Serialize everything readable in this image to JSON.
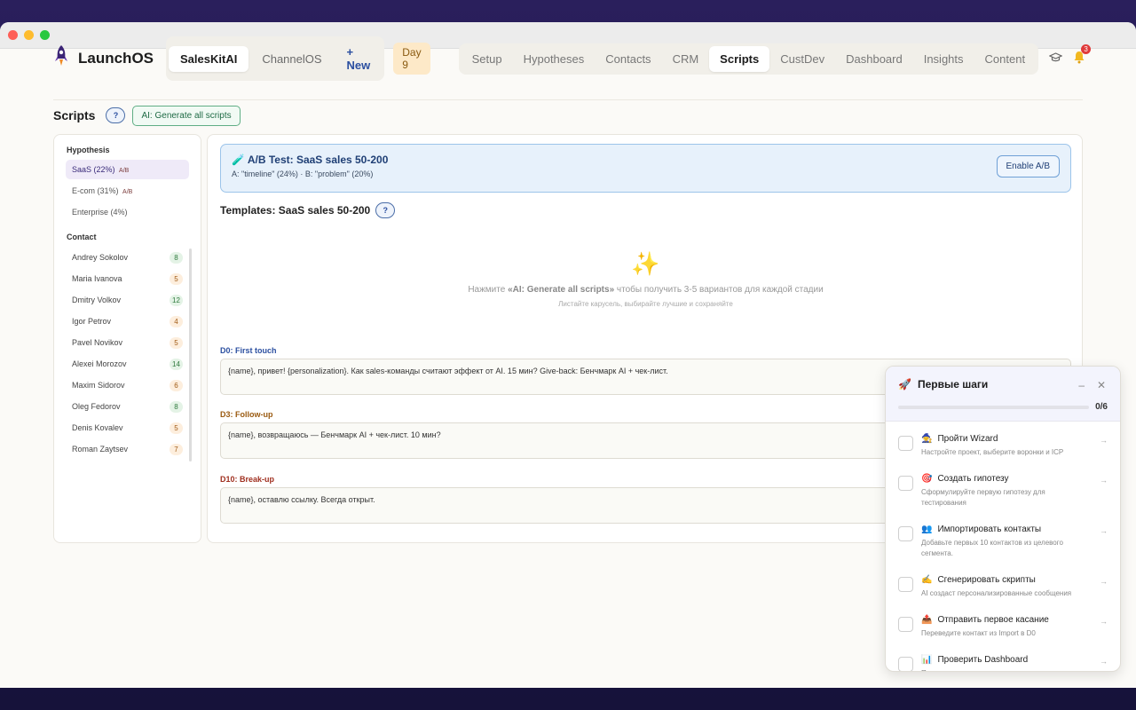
{
  "app": {
    "name": "LaunchOS"
  },
  "project_tabs": [
    {
      "label": "SalesKitAI",
      "active": true
    },
    {
      "label": "ChannelOS",
      "active": false
    },
    {
      "label": "+ New",
      "active": false
    }
  ],
  "day_badge": "Day 9",
  "nav_tabs": [
    {
      "label": "Setup"
    },
    {
      "label": "Hypotheses"
    },
    {
      "label": "Contacts"
    },
    {
      "label": "CRM"
    },
    {
      "label": "Scripts"
    },
    {
      "label": "CustDev"
    },
    {
      "label": "Dashboard"
    },
    {
      "label": "Insights"
    },
    {
      "label": "Content"
    }
  ],
  "active_nav": "Scripts",
  "notifications_count": "3",
  "page": {
    "title": "Scripts",
    "help": "?",
    "ai_button": "AI: Generate all scripts"
  },
  "sidebar": {
    "hypothesis_heading": "Hypothesis",
    "hypotheses": [
      {
        "label": "SaaS (22%)",
        "tag": "A/B"
      },
      {
        "label": "E-com (31%)",
        "tag": "A/B"
      },
      {
        "label": "Enterprise (4%)",
        "tag": ""
      }
    ],
    "contact_heading": "Contact",
    "contacts": [
      {
        "name": "Andrey Sokolov",
        "count": "8",
        "color": "green"
      },
      {
        "name": "Maria Ivanova",
        "count": "5",
        "color": "orange"
      },
      {
        "name": "Dmitry Volkov",
        "count": "12",
        "color": "green"
      },
      {
        "name": "Igor Petrov",
        "count": "4",
        "color": "orange"
      },
      {
        "name": "Pavel Novikov",
        "count": "5",
        "color": "orange"
      },
      {
        "name": "Alexei Morozov",
        "count": "14",
        "color": "green"
      },
      {
        "name": "Maxim Sidorov",
        "count": "6",
        "color": "orange"
      },
      {
        "name": "Oleg Fedorov",
        "count": "8",
        "color": "green"
      },
      {
        "name": "Denis Kovalev",
        "count": "5",
        "color": "orange"
      },
      {
        "name": "Roman Zaytsev",
        "count": "7",
        "color": "orange"
      }
    ]
  },
  "ab_test": {
    "title": "A/B Test: SaaS sales 50-200",
    "subtitle": "A: \"timeline\" (24%) · B: \"problem\" (20%)",
    "enable_button": "Enable A/B"
  },
  "templates": {
    "title": "Templates: SaaS sales 50-200",
    "help": "?",
    "empty_prefix": "Нажмите ",
    "empty_bold": "«AI: Generate all scripts»",
    "empty_suffix": " чтобы получить 3-5 вариантов для каждой стадии",
    "empty_sub": "Листайте карусель, выбирайте лучшие и сохраняйте"
  },
  "stages": [
    {
      "label": "D0: First touch",
      "text": "{name}, привет! {personalization}. Как sales-команды считают эффект от AI. 15 мин? Give-back: Бенчмарк AI + чек-лист.",
      "color": "#2b4fa0"
    },
    {
      "label": "D3: Follow-up",
      "text": "{name}, возвращаюсь — Бенчмарк AI + чек-лист. 10 мин?",
      "color": "#9a5a10"
    },
    {
      "label": "D10: Break-up",
      "text": "{name}, оставлю ссылку. Всегда открыт.",
      "color": "#a03020"
    }
  ],
  "onboarding": {
    "title": "Первые шаги",
    "progress_text": "0/6",
    "progress_fraction": 0,
    "items": [
      {
        "icon": "🧙",
        "title": "Пройти Wizard",
        "desc": "Настройте проект, выберите воронки и ICP"
      },
      {
        "icon": "🎯",
        "title": "Создать гипотезу",
        "desc": "Сформулируйте первую гипотезу для тестирования"
      },
      {
        "icon": "👥",
        "title": "Импортировать контакты",
        "desc": "Добавьте первых 10 контактов из целевого сегмента."
      },
      {
        "icon": "✍️",
        "title": "Сгенерировать скрипты",
        "desc": "AI создаст персонализированные сообщения"
      },
      {
        "icon": "📤",
        "title": "Отправить первое касание",
        "desc": "Переведите контакт из Import в D0"
      },
      {
        "icon": "📊",
        "title": "Проверить Dashboard",
        "desc": "Посмотрите метрики и конверсии"
      }
    ]
  }
}
